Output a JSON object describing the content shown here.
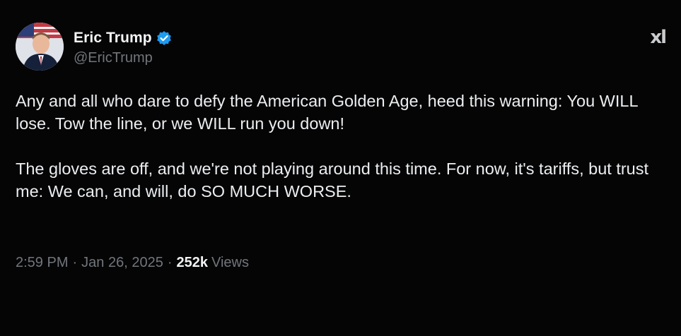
{
  "author": {
    "display_name": "Eric Trump",
    "handle": "@EricTrump",
    "verified": true,
    "verified_color": "#1d9bf0"
  },
  "platform_logo": "xl",
  "tweet": {
    "paragraphs": [
      "Any and all who dare to defy the American Golden Age, heed this warning: You WILL lose. Tow the line, or we WILL run you down!",
      "The gloves are off, and we're not playing around this time. For now, it's tariffs, but trust me: We can, and will, do SO MUCH WORSE."
    ]
  },
  "meta": {
    "time": "2:59 PM",
    "separator": "·",
    "date": "Jan 26, 2025",
    "views_count": "252k",
    "views_label": "Views"
  },
  "icons": {
    "avatar": "profile-photo",
    "verified": "verified-badge-icon",
    "logo": "x-logo-icon"
  }
}
